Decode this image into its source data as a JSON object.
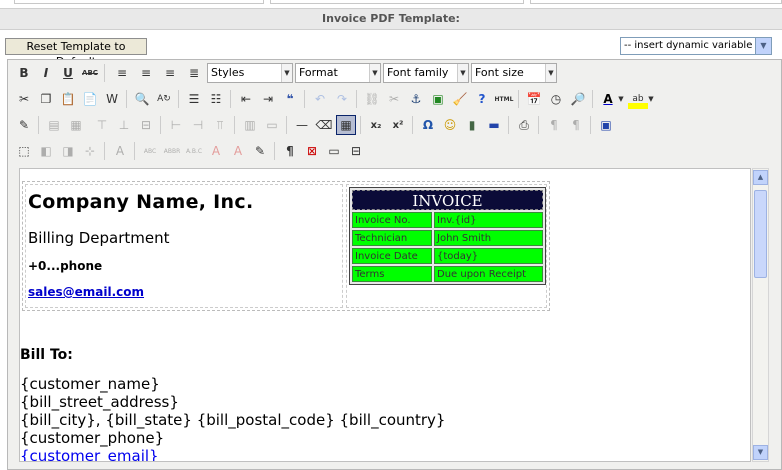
{
  "page": {
    "title": "Invoice PDF Template:"
  },
  "controls": {
    "reset_label": "Reset Template to Default",
    "dynamic_variable": "-- insert dynamic variable --"
  },
  "toolbar": {
    "bold": "B",
    "italic": "I",
    "underline": "U",
    "strike": "ABC",
    "styles": "Styles",
    "format": "Format",
    "font_family": "Font family",
    "font_size": "Font size",
    "subscript": "x₂",
    "superscript": "x²",
    "omega": "Ω",
    "pilcrow": "¶",
    "html": "HTML"
  },
  "document": {
    "company_name": "Company Name, Inc.",
    "department": "Billing Department",
    "phone": "+0...phone",
    "email": "sales@email.com",
    "invoice_title": "INVOICE",
    "invoice_rows": [
      {
        "label": "Invoice No.",
        "value": "Inv.{id}"
      },
      {
        "label": "Technician",
        "value": "John Smith"
      },
      {
        "label": "Invoice Date",
        "value": "{today}"
      },
      {
        "label": "Terms",
        "value": "Due upon Receipt"
      }
    ],
    "bill_to": "Bill To:",
    "address_lines": [
      "{customer_name}",
      "{bill_street_address}",
      "{bill_city}, {bill_state} {bill_postal_code} {bill_country}",
      "{customer_phone}",
      "{customer_email}"
    ]
  },
  "colors": {
    "invoice_header_bg": "#0b0b38",
    "invoice_cell_bg": "#00ff00",
    "link": "#0000ee"
  }
}
